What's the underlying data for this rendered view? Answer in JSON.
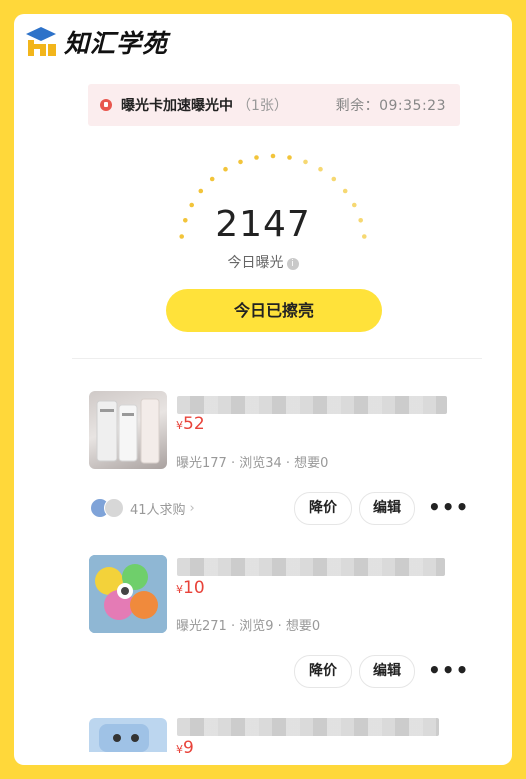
{
  "logo": {
    "text": "知汇学苑"
  },
  "notice": {
    "title": "曝光卡加速曝光中",
    "count": "（1张）",
    "timer": "剩余：09:35:23"
  },
  "exposure": {
    "number": "2147",
    "label": "今日曝光",
    "info_icon": "i"
  },
  "polish_button": "今日已擦亮",
  "items": [
    {
      "price_symbol": "¥",
      "price": "52",
      "stats": "曝光177 · 浏览34 · 想要0",
      "buyers": "41人求购",
      "buyers_chevron": "›",
      "btn_reduce": "降价",
      "btn_edit": "编辑",
      "more": "•••"
    },
    {
      "price_symbol": "¥",
      "price": "10",
      "stats": "曝光271 · 浏览9 · 想要0",
      "btn_reduce": "降价",
      "btn_edit": "编辑",
      "more": "•••"
    },
    {
      "price_symbol": "¥",
      "price": "9"
    }
  ],
  "colors": {
    "frame": "#FFD83A",
    "accent": "#FFE23A",
    "price": "#E8433A",
    "notice_bg": "#FBEDEE"
  },
  "icons": [
    "logo-mark-icon",
    "notice-dot-icon",
    "info-icon",
    "more-icon"
  ]
}
